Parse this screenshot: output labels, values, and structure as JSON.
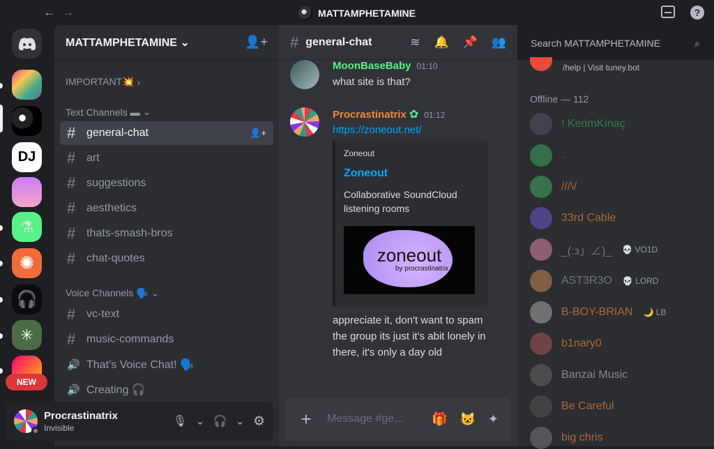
{
  "nav": {
    "back": "←",
    "forward": "→"
  },
  "window_title": "MATTAMPHETAMINE",
  "help_glyph": "?",
  "server": {
    "name": "MATTAMPHETAMINE"
  },
  "guilds_new_badge": "NEW",
  "categories": {
    "important": "IMPORTANT💥",
    "text": "Text Channels ▬",
    "voice": "Voice Channels 🗣️"
  },
  "channels": [
    {
      "name": "general-chat",
      "active": true
    },
    {
      "name": "art"
    },
    {
      "name": "suggestions"
    },
    {
      "name": "aesthetics"
    },
    {
      "name": "thats-smash-bros"
    },
    {
      "name": "chat-quotes"
    }
  ],
  "voice_channels": [
    {
      "name": "vc-text",
      "type": "text"
    },
    {
      "name": "music-commands",
      "type": "text"
    },
    {
      "name": "That’s Voice Chat! 🗣️",
      "type": "voice"
    },
    {
      "name": "Creating 🎧",
      "type": "voice"
    }
  ],
  "user": {
    "name": "Procrastinatrix",
    "status": "Invisible"
  },
  "channel_header": {
    "name": "general-chat"
  },
  "search": {
    "placeholder": "Search MATTAMPHETAMINE"
  },
  "messages": [
    {
      "author": "MoonBaseBaby",
      "time": "01:10",
      "text": "what site is that?",
      "color": "#57f287"
    },
    {
      "author": "Procrastinatrix",
      "time": "01:12",
      "link": "https://zoneout.net/",
      "color": "#f0883e",
      "continuation": "appreciate it, don't want to spam the group its just it's abit lonely in there, it's only a day old"
    }
  ],
  "embed": {
    "provider": "Zoneout",
    "title": "Zoneout",
    "description": "Collaborative SoundCloud listening rooms",
    "image_text": "zoneout",
    "image_sub": "by procrastinatrix"
  },
  "composer": {
    "placeholder": "Message #ge..."
  },
  "members": {
    "bot_line": "/help | Visit tuney.bot",
    "offline_header": "Offline — 112",
    "list": [
      {
        "name": "! KerimKınaç",
        "badge": "",
        "color": "#3ba55c"
      },
      {
        "name": ".",
        "badge": "",
        "color": "#3ba55c"
      },
      {
        "name": "///\\/",
        "badge": "",
        "color": "#f0883e"
      },
      {
        "name": "33rd Cable",
        "badge": "",
        "color": "#f0883e"
      },
      {
        "name": "_(:з」∠)_",
        "badge": "💀 VO1D",
        "color": "#949ba4"
      },
      {
        "name": "AST3R3O",
        "badge": "💀 LORD",
        "color": "#949ba4"
      },
      {
        "name": "B-BOY-BRIAN",
        "badge": "🌙 LB",
        "color": "#f0883e"
      },
      {
        "name": "b1nary0",
        "badge": "",
        "color": "#f0883e"
      },
      {
        "name": "Banzai Music",
        "badge": "",
        "color": "#b5bac1"
      },
      {
        "name": "Be Careful",
        "badge": "",
        "color": "#f0883e"
      },
      {
        "name": "big chris",
        "badge": "",
        "color": "#f0883e"
      }
    ]
  }
}
